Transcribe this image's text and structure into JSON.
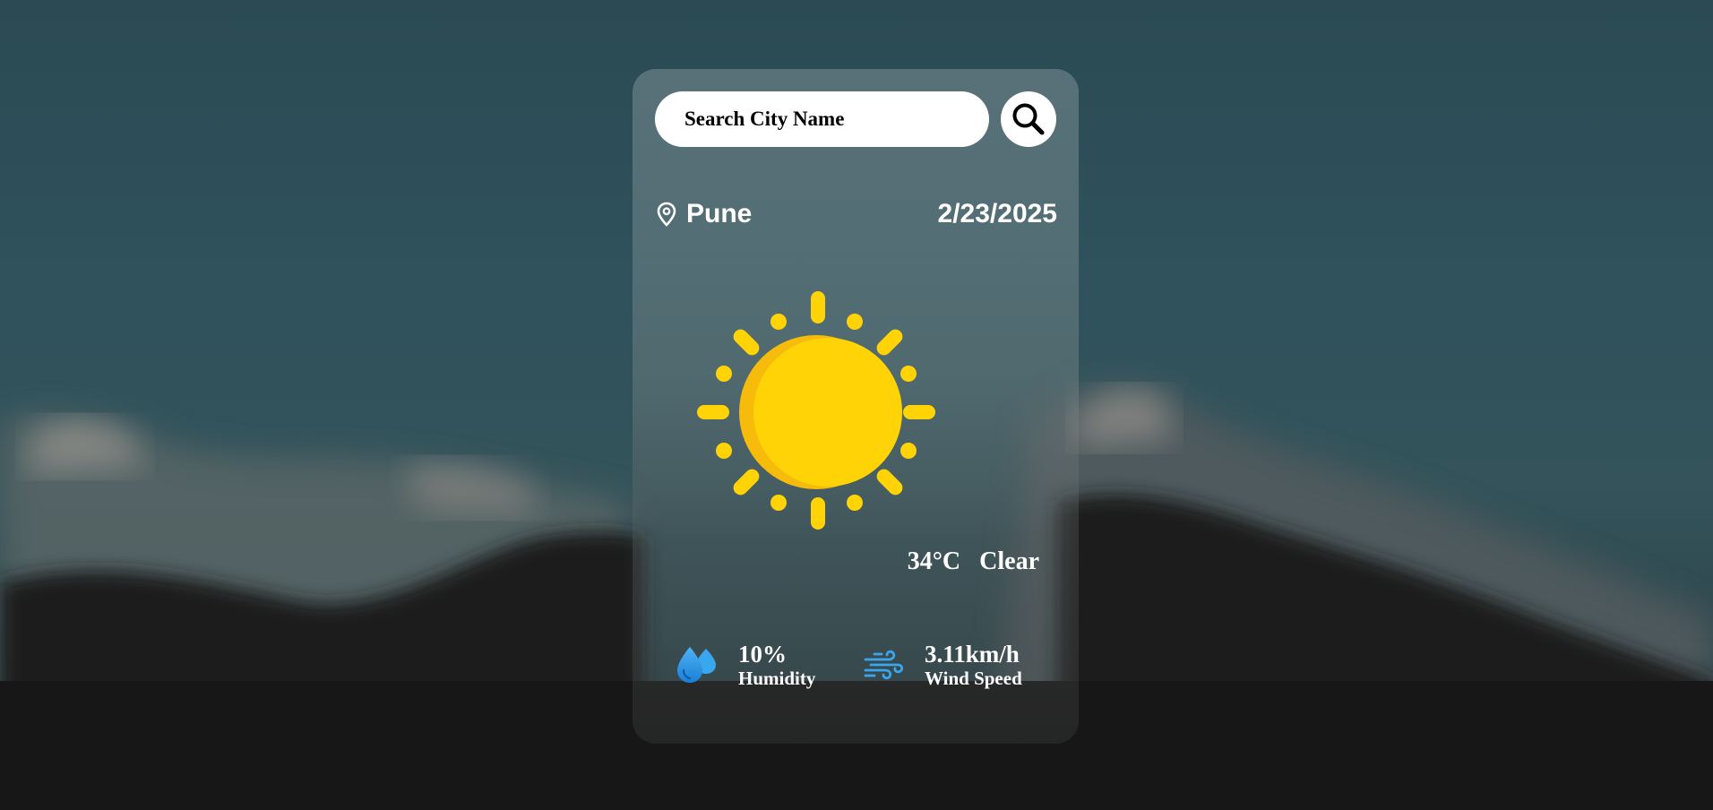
{
  "search": {
    "placeholder": "Search City Name",
    "value": ""
  },
  "location": {
    "city": "Pune",
    "date": "2/23/2025"
  },
  "weather": {
    "temperature": "34°C",
    "condition": "Clear",
    "icon": "sun-icon"
  },
  "stats": {
    "humidity": {
      "value": "10%",
      "label": "Humidity",
      "icon": "water-drops-icon"
    },
    "wind": {
      "value": "3.11km/h",
      "label": "Wind Speed",
      "icon": "wind-icon"
    }
  },
  "colors": {
    "sun": "#ffd306",
    "sun_shade": "#f7bc0b",
    "accent_blue": "#2f9bea",
    "text": "#ffffff"
  }
}
